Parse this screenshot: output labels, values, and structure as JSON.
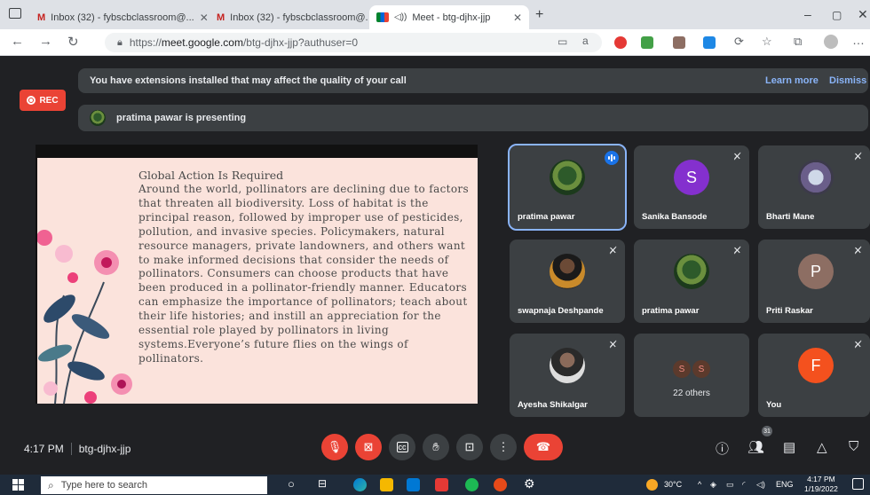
{
  "browser": {
    "tabs": [
      {
        "label": "Inbox (32) - fybscbclassroom@..."
      },
      {
        "label": "Inbox (32) - fybscbclassroom@..."
      },
      {
        "label": "Meet - btg-djhx-jjp"
      }
    ],
    "url_prefix": "https://",
    "url_domain": "meet.google.com",
    "url_path": "/btg-djhx-jjp?authuser=0"
  },
  "banners": {
    "extensions_text": "You have extensions installed that may affect the quality of your call",
    "learn_more": "Learn more",
    "dismiss": "Dismiss",
    "presenting_text": "pratima pawar is presenting"
  },
  "rec_label": "REC",
  "slide": {
    "title": "Global Action Is Required",
    "body": "Around the world, pollinators are declining due to factors that threaten all biodiversity. Loss of habitat is the principal reason, followed by improper use of pesticides, pollution, and invasive species. Policymakers, natural resource managers, private landowners, and others want to make informed decisions that consider the needs of pollinators. Consumers can choose products that have been produced in a pollinator-friendly manner. Educators can emphasize the importance of pollinators; teach about their life histories; and instill an appreciation for the essential role played by pollinators in living systems.Everyone’s future flies on the wings of pollinators."
  },
  "participants": [
    {
      "name": "pratima pawar",
      "avatar": "photo",
      "speaking": true
    },
    {
      "name": "Sanika Bansode",
      "initial": "S",
      "color": "#8430ce"
    },
    {
      "name": "Bharti Mane",
      "avatar": "photo-bird"
    },
    {
      "name": "swapnaja Deshpande",
      "avatar": "photo-person"
    },
    {
      "name": "pratima pawar",
      "avatar": "photo"
    },
    {
      "name": "Priti Raskar",
      "initial": "P",
      "color": "#8d6e63"
    },
    {
      "name": "Ayesha Shikalgar",
      "avatar": "photo-person2"
    },
    {
      "name": "22 others",
      "mini": [
        "S",
        "S"
      ]
    },
    {
      "name": "You",
      "initial": "F",
      "color": "#f4511e"
    }
  ],
  "controls": {
    "time": "4:17 PM",
    "meeting_code": "btg-djhx-jjp",
    "people_count": "31"
  },
  "taskbar": {
    "search_placeholder": "Type here to search",
    "temperature": "30°C",
    "language": "ENG",
    "time": "4:17 PM",
    "date": "1/19/2022"
  }
}
